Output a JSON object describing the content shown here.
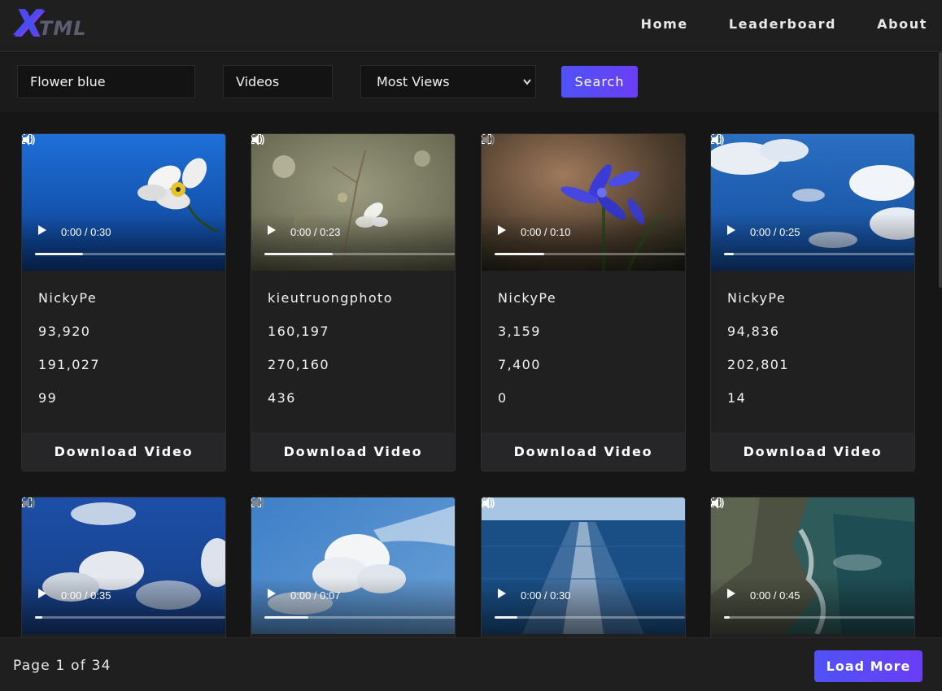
{
  "header": {
    "logo_x": "X",
    "logo_tml": "TML",
    "nav": [
      "Home",
      "Leaderboard",
      "About"
    ]
  },
  "search": {
    "query": "Flower blue",
    "type": "Videos",
    "sort": "Most Views",
    "button": "Search"
  },
  "download_label": "Download Video",
  "cards": [
    {
      "time": "0:00 / 0:30",
      "progress": 0.25,
      "user": "NickyPe",
      "stat1": "93,920",
      "stat2": "191,027",
      "stat3": "99",
      "thumb": "white-anemone"
    },
    {
      "time": "0:00 / 0:23",
      "progress": 0.36,
      "user": "kieutruongphoto",
      "stat1": "160,197",
      "stat2": "270,160",
      "stat3": "436",
      "thumb": "white-flower-bokeh"
    },
    {
      "time": "0:00 / 0:10",
      "progress": 0.26,
      "user": "NickyPe",
      "stat1": "3,159",
      "stat2": "7,400",
      "stat3": "0",
      "thumb": "blue-flowers"
    },
    {
      "time": "0:00 / 0:25",
      "progress": 0.05,
      "user": "NickyPe",
      "stat1": "94,836",
      "stat2": "202,801",
      "stat3": "14",
      "thumb": "blue-sky-clouds"
    },
    {
      "time": "0:00 / 0:35",
      "progress": 0.04,
      "thumb": "clouds-dark-sky"
    },
    {
      "time": "0:00 / 0:07",
      "progress": 0.23,
      "thumb": "cumulus-cloud"
    },
    {
      "time": "0:00 / 0:30",
      "progress": 0.12,
      "thumb": "ocean-wake"
    },
    {
      "time": "0:00 / 0:45",
      "progress": 0.03,
      "thumb": "rocky-coast"
    }
  ],
  "footer": {
    "page_info": "Page 1 of 34",
    "load_more": "Load More"
  }
}
